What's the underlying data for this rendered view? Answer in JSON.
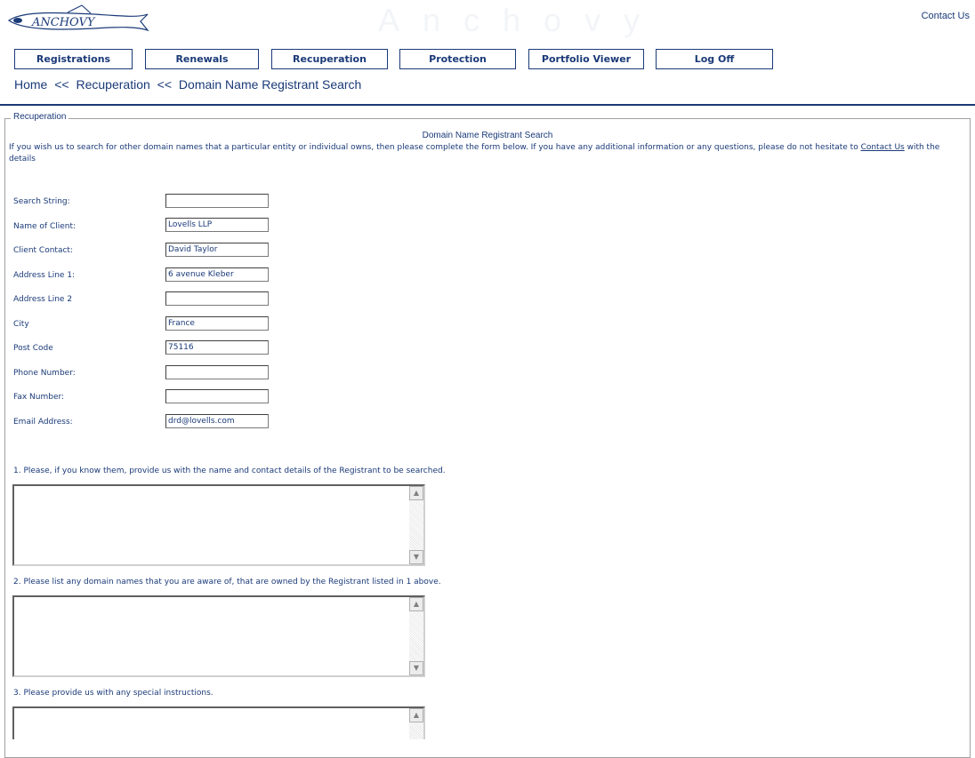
{
  "header": {
    "logo_icon": "anchovy-fish-logo",
    "logo_text": "ANCHOVY",
    "watermark": "Anchovy",
    "contact_link": "Contact Us"
  },
  "nav": {
    "items": [
      {
        "label": "Registrations"
      },
      {
        "label": "Renewals"
      },
      {
        "label": "Recuperation"
      },
      {
        "label": "Protection"
      },
      {
        "label": "Portfolio Viewer"
      },
      {
        "label": "Log Off"
      }
    ]
  },
  "breadcrumb": {
    "home": "Home",
    "separator": "<<",
    "section": "Recuperation",
    "page": "Domain Name Registrant Search"
  },
  "form": {
    "legend": "Recuperation",
    "title": "Domain Name Registrant Search",
    "intro_before": "If you wish us to search for other domain names that a particular entity or individual owns, then please complete the form below. If you have any additional information or any questions, please do not hesitate to ",
    "intro_link": "Contact Us",
    "intro_after": " with the details",
    "fields": [
      {
        "label": "Search String:",
        "value": ""
      },
      {
        "label": "Name of Client:",
        "value": "Lovells LLP"
      },
      {
        "label": "Client Contact:",
        "value": "David Taylor"
      },
      {
        "label": "Address Line 1:",
        "value": "6 avenue Kleber"
      },
      {
        "label": "Address Line 2",
        "value": ""
      },
      {
        "label": "City",
        "value": "France"
      },
      {
        "label": "Post Code",
        "value": "75116"
      },
      {
        "label": "Phone Number:",
        "value": ""
      },
      {
        "label": "Fax Number:",
        "value": ""
      },
      {
        "label": "Email Address:",
        "value": "drd@lovells.com"
      }
    ],
    "questions": [
      {
        "label": "1. Please, if you know them, provide us with the name and contact details of the Registrant to be searched.",
        "value": ""
      },
      {
        "label": "2. Please list any domain names that you are aware of, that are owned by the Registrant listed in 1 above.",
        "value": ""
      },
      {
        "label": "3. Please provide us with any special instructions.",
        "value": ""
      }
    ]
  },
  "colors": {
    "accent": "#1a3a78",
    "border": "#a0a0a0"
  }
}
